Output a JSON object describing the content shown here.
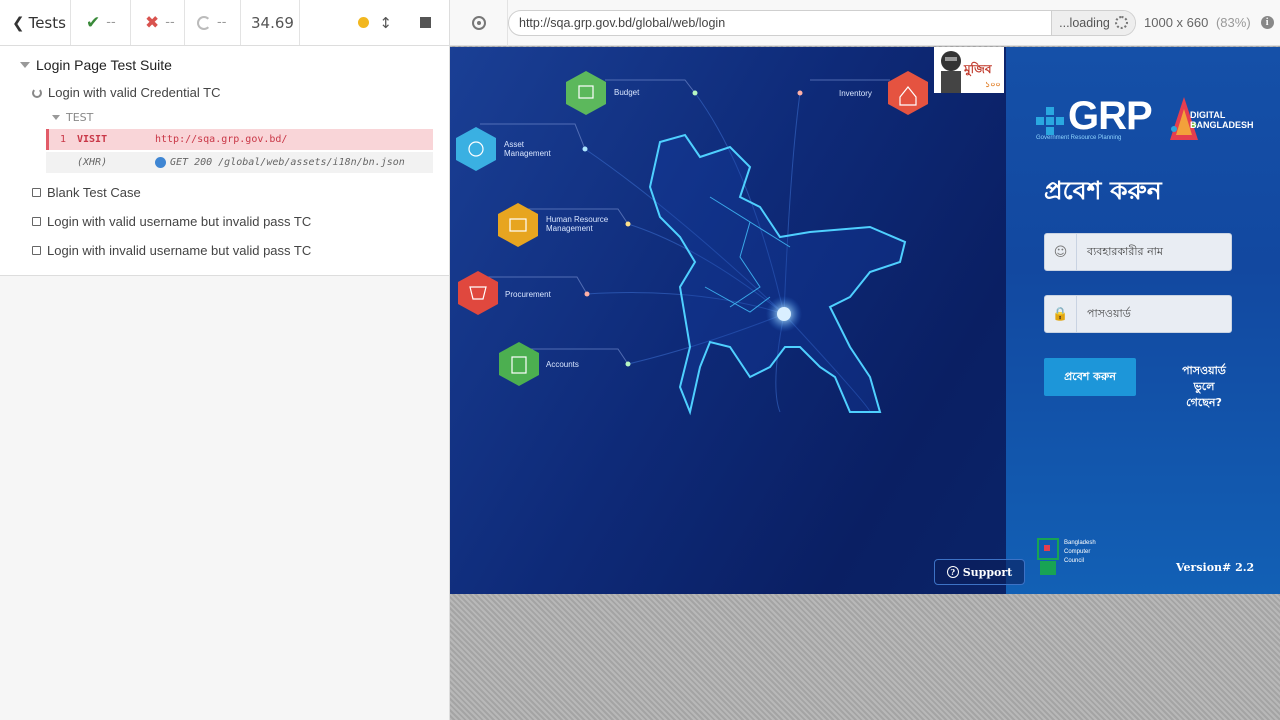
{
  "reporter": {
    "tests_label": "Tests",
    "passed": "--",
    "failed": "--",
    "pending": "--",
    "duration": "34.69",
    "suite_title": "Login Page Test Suite",
    "tests": [
      {
        "title": "Login with valid Credential TC",
        "state": "running"
      },
      {
        "title": "Blank Test Case",
        "state": "pending"
      },
      {
        "title": "Login with valid username but invalid pass TC",
        "state": "pending"
      },
      {
        "title": "Login with invalid username but valid pass TC",
        "state": "pending"
      }
    ],
    "hook_label": "TEST",
    "commands": [
      {
        "num": "1",
        "name": "VISIT",
        "message": "http://sqa.grp.gov.bd/",
        "state": "failed"
      },
      {
        "num": "",
        "name": "(XHR)",
        "message": "GET 200 /global/web/assets/i18n/bn.json",
        "state": "xhr"
      }
    ]
  },
  "url_bar": {
    "url": "http://sqa.grp.gov.bd/global/web/login",
    "loading_label": "...loading",
    "viewport": "1000 x 660",
    "scale": "(83%)"
  },
  "aut": {
    "modules": [
      {
        "label": "Budget",
        "color": "#5cb85c"
      },
      {
        "label": "Inventory",
        "color": "#e55340"
      },
      {
        "label": "Asset Management",
        "color": "#3ab0e2"
      },
      {
        "label": "Human Resource Management",
        "color": "#e7a520"
      },
      {
        "label": "Procurement",
        "color": "#e0483e"
      },
      {
        "label": "Accounts",
        "color": "#4caf50"
      }
    ],
    "grp_logo": "GRP",
    "grp_sub": "Government Resource Planning",
    "digital_logo": "DIGITAL BANGLADESH",
    "login_title": "প্রবেশ করুন",
    "username_placeholder": "ব্যবহারকারীর নাম",
    "password_placeholder": "পাসওয়ার্ড",
    "login_button": "প্রবেশ করুন",
    "forgot_password": "পাসওয়ার্ড ভুলে গেছেন?",
    "bcc_text": "Bangladesh Computer Council",
    "support": "Support",
    "version": "Version# 2.2",
    "mujib_text": "মুজিব",
    "mujib_num": "১০০"
  }
}
